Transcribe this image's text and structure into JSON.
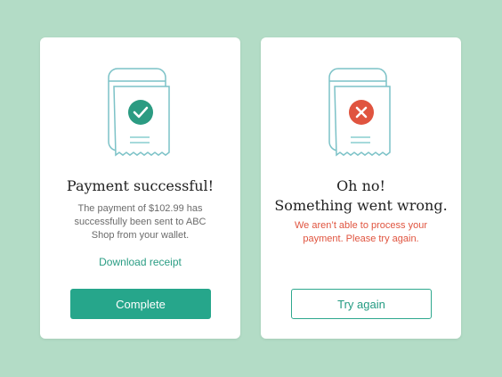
{
  "colors": {
    "background": "#b3dcc6",
    "accent": "#26a68b",
    "error": "#e0543f",
    "line": "#7cc2c7"
  },
  "success_card": {
    "icon": "checkmark-icon",
    "title": "Payment successful!",
    "description": "The payment of $102.99 has successfully been sent to ABC Shop from your wallet.",
    "link_label": "Download receipt",
    "button_label": "Complete"
  },
  "error_card": {
    "icon": "cross-icon",
    "title_line1": "Oh no!",
    "title_line2": "Something went wrong.",
    "description": "We aren’t able to process your payment. Please try again.",
    "button_label": "Try again"
  }
}
